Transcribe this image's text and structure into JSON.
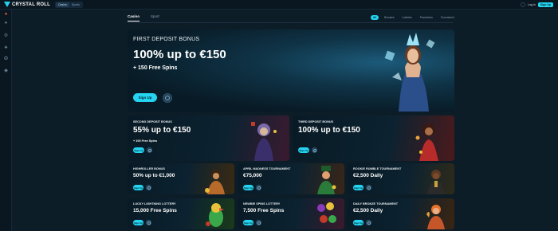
{
  "brand": {
    "name": "CRYSTAL ROLL"
  },
  "mode_switch": [
    "Casino",
    "Sports"
  ],
  "top_right": {
    "login": "Log in",
    "signup": "Sign Up"
  },
  "tabs": [
    "Casino",
    "Sport"
  ],
  "filters": [
    "All",
    "Bonuses",
    "Lotteries",
    "Promotions",
    "Tournament"
  ],
  "hero": {
    "label": "FIRST DEPOSIT BONUS",
    "title": "100% up to €150",
    "sub": "+ 150 Free Spins",
    "button": "Sign Up"
  },
  "cards": [
    {
      "label": "SECOND DEPOSIT BONUS",
      "title": "55% up to €150",
      "sub": "+ 100 Free Spins",
      "button": "Sign Up"
    },
    {
      "label": "THIRD DEPOSIT BONUS",
      "title": "100% up to €150",
      "button": "Sign Up"
    }
  ],
  "small_cards": [
    {
      "label": "HIGHROLLER BONUS",
      "title": "50% up to €1,000",
      "button": "Sign Up"
    },
    {
      "label": "APRIL MADNESS TOURNAMENT",
      "title": "€75,000",
      "button": "Sign Up"
    },
    {
      "label": "ROOKIE RUMBLE TOURNAMENT",
      "title": "€2,500 Daily",
      "button": "Sign Up"
    },
    {
      "label": "LUCKY LIGHTNING LOTTERY",
      "title": "15,000 Free Spins",
      "button": "Sign Up"
    },
    {
      "label": "NEWBIE SPINS LOTTERY",
      "title": "7,500 Free Spins",
      "button": "Sign Up"
    },
    {
      "label": "DAILY BRONZE TOURNAMENT",
      "title": "€2,500 Daily",
      "button": "Sign Up"
    }
  ],
  "colors": {
    "accent": "#24d4f0",
    "background": "#0d1d27",
    "card": "#0b2433"
  }
}
